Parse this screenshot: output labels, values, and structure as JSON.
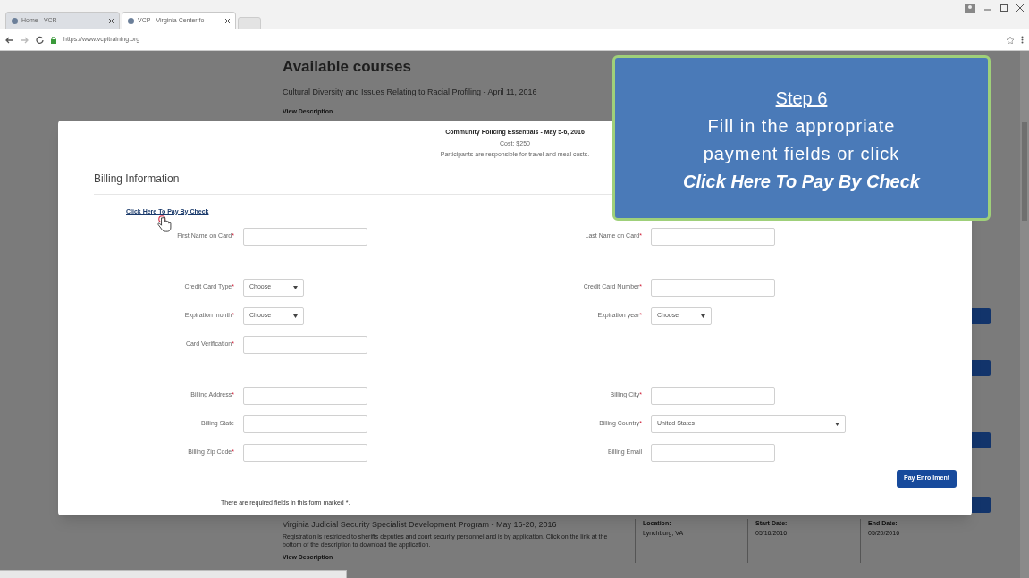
{
  "browser": {
    "tabs": [
      {
        "title": "Home - VCR",
        "selected": false
      },
      {
        "title": "VCP - Virginia Center fo",
        "selected": true
      }
    ],
    "url": "https://www.vcpitraining.org"
  },
  "page": {
    "heading": "Available courses",
    "courses": [
      {
        "title": "Cultural Diversity and Issues Relating to Racial Profiling - April 11, 2016",
        "link": "View Description"
      }
    ],
    "bottom_course": {
      "title": "Virginia Judicial Security Specialist Development Program - May 16-20, 2016",
      "description": "Registration is restricted to sheriffs deputies and court security personnel and is by application. Click on the link at the bottom of the description to download the application.",
      "link": "View Description",
      "details": [
        {
          "label": "Location:",
          "value": "Lynchburg, VA"
        },
        {
          "label": "Start Date:",
          "value": "05/16/2016"
        },
        {
          "label": "End Date:",
          "value": "05/20/2016"
        }
      ]
    }
  },
  "modal": {
    "course_title": "Community Policing Essentials - May 5-6, 2016",
    "cost": "Cost: $250",
    "note": "Participants are responsible for travel and meal costs.",
    "section_title": "Billing Information",
    "pay_by_check_link": "Click Here To Pay By Check",
    "sections": [
      {
        "rows": [
          {
            "left": {
              "label": "First Name on Card",
              "required_mark": "*",
              "kind": "input"
            },
            "right": {
              "label": "Last Name on Card",
              "required_mark": "*",
              "kind": "input"
            }
          }
        ]
      },
      {
        "rows": [
          {
            "left": {
              "label": "Credit Card Type",
              "required_mark": "*",
              "kind": "select",
              "value": "Choose"
            },
            "right": {
              "label": "Credit Card Number",
              "required_mark": "*",
              "kind": "input"
            }
          },
          {
            "left": {
              "label": "Expiration month",
              "required_mark": "*",
              "kind": "select",
              "value": "Choose"
            },
            "right": {
              "label": "Expiration year",
              "required_mark": "*",
              "kind": "select",
              "value": "Choose"
            }
          },
          {
            "left": {
              "label": "Card Verification",
              "required_mark": "*",
              "kind": "input"
            }
          }
        ]
      },
      {
        "rows": [
          {
            "left": {
              "label": "Billing Address",
              "required_mark": "*",
              "kind": "input"
            },
            "right": {
              "label": "Billing City",
              "required_mark": "*",
              "kind": "input"
            }
          },
          {
            "left": {
              "label": "Billing State",
              "kind": "input"
            },
            "right": {
              "label": "Billing Country",
              "required_mark": "*",
              "kind": "long-select",
              "value": "United States"
            }
          },
          {
            "left": {
              "label": "Billing Zip Code",
              "required_mark": "*",
              "kind": "input"
            },
            "right": {
              "label": "Billing Email",
              "kind": "input"
            }
          }
        ]
      }
    ],
    "submit": "Pay Enrollment",
    "footnote": "There are required fields in this form marked *."
  },
  "callout": {
    "step": "Step 6",
    "lines": [
      "Fill in the appropriate",
      "payment fields or click"
    ],
    "emphasis": "Click Here To Pay By Check"
  }
}
